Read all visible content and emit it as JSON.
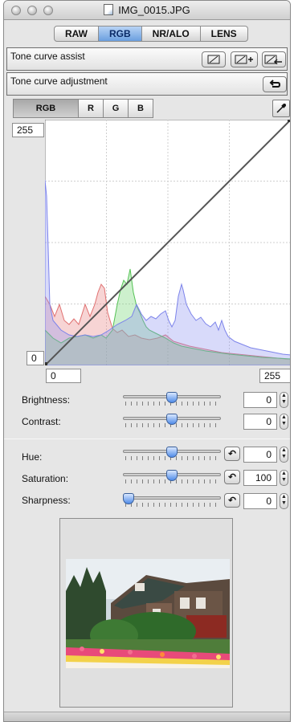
{
  "window": {
    "title": "IMG_0015.JPG"
  },
  "tabs": [
    {
      "label": "RAW",
      "active": false
    },
    {
      "label": "RGB",
      "active": true
    },
    {
      "label": "NR/ALO",
      "active": false
    },
    {
      "label": "LENS",
      "active": false
    }
  ],
  "tone_curve_assist": {
    "label": "Tone curve assist"
  },
  "tone_curve_adjustment": {
    "label": "Tone curve adjustment",
    "channels": [
      {
        "label": "RGB",
        "active": true
      },
      {
        "label": "R",
        "active": false
      },
      {
        "label": "G",
        "active": false
      },
      {
        "label": "B",
        "active": false
      }
    ],
    "input_max": "255",
    "input_min": "0",
    "output_min": "0",
    "output_max": "255"
  },
  "colors": {
    "accent": "#5b92e5",
    "histogram_red": "#e88484",
    "histogram_green": "#6fd36f",
    "histogram_blue": "#8f95f0"
  },
  "adjustments_top": [
    {
      "label": "Brightness:",
      "value": "0",
      "level": 0.5
    },
    {
      "label": "Contrast:",
      "value": "0",
      "level": 0.5
    }
  ],
  "adjustments_bottom": [
    {
      "label": "Hue:",
      "value": "0",
      "level": 0.5
    },
    {
      "label": "Saturation:",
      "value": "100",
      "level": 0.5
    },
    {
      "label": "Sharpness:",
      "value": "0",
      "level": 0.0
    }
  ],
  "icons": {
    "eyedropper": "eyedropper-icon",
    "reset": "reset-arrow-icon",
    "stepper": "stepper-arrows-icon"
  }
}
